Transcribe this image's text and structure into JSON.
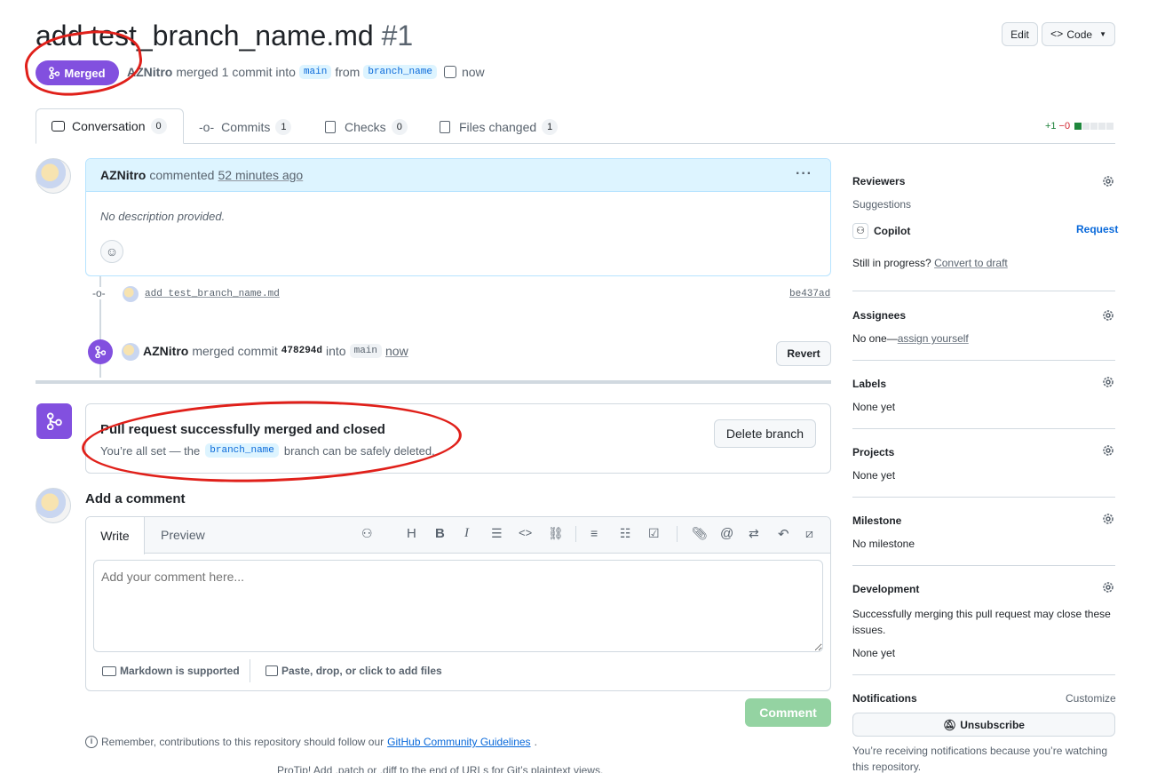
{
  "pr": {
    "title": "add test_branch_name.md",
    "number": "#1",
    "state": "Merged",
    "author": "AZNitro",
    "merge_text": "merged 1 commit into",
    "base_branch": "main",
    "from_text": "from",
    "head_branch": "branch_name",
    "time": "now"
  },
  "header_buttons": {
    "edit": "Edit",
    "code": "Code"
  },
  "tabs": [
    {
      "label": "Conversation",
      "count": "0"
    },
    {
      "label": "Commits",
      "count": "1"
    },
    {
      "label": "Checks",
      "count": "0"
    },
    {
      "label": "Files changed",
      "count": "1"
    }
  ],
  "diffstat": {
    "add": "+1",
    "del": "−0"
  },
  "comment": {
    "author": "AZNitro",
    "action": "commented",
    "time": "52 minutes ago",
    "body": "No description provided."
  },
  "commit": {
    "message": "add test_branch_name.md",
    "sha": "be437ad"
  },
  "merge_event": {
    "author": "AZNitro",
    "action": "merged commit",
    "sha": "478294d",
    "into": "into",
    "branch": "main",
    "time": "now",
    "revert_label": "Revert"
  },
  "merged_box": {
    "title": "Pull request successfully merged and closed",
    "text_before": "You’re all set — the",
    "branch": "branch_name",
    "text_after": "branch can be safely deleted.",
    "delete_label": "Delete branch"
  },
  "add_comment": {
    "heading": "Add a comment",
    "tab_write": "Write",
    "tab_preview": "Preview",
    "placeholder": "Add your comment here...",
    "markdown_note": "Markdown is supported",
    "attach_note": "Paste, drop, or click to add files",
    "submit_label": "Comment"
  },
  "footer": {
    "remember_text": "Remember, contributions to this repository should follow our",
    "guidelines_link": "GitHub Community Guidelines",
    "protip": "ProTip! Add .patch or .diff to the end of URLs for Git’s plaintext views."
  },
  "sidebar": {
    "reviewers": {
      "title": "Reviewers",
      "suggestions": "Suggestions",
      "copilot": "Copilot",
      "request": "Request",
      "in_progress": "Still in progress?",
      "convert": "Convert to draft"
    },
    "assignees": {
      "title": "Assignees",
      "none": "No one—",
      "assign": "assign yourself"
    },
    "labels": {
      "title": "Labels",
      "value": "None yet"
    },
    "projects": {
      "title": "Projects",
      "value": "None yet"
    },
    "milestone": {
      "title": "Milestone",
      "value": "No milestone"
    },
    "development": {
      "title": "Development",
      "text": "Successfully merging this pull request may close these issues.",
      "value": "None yet"
    },
    "notifications": {
      "title": "Notifications",
      "customize": "Customize",
      "unsubscribe": "Unsubscribe",
      "reason": "You’re receiving notifications because you’re watching this repository."
    }
  },
  "colors": {
    "merged": "#8250df",
    "accent": "#0969da",
    "annotation": "#e0201a",
    "comment_btn": "#94d3a2"
  }
}
